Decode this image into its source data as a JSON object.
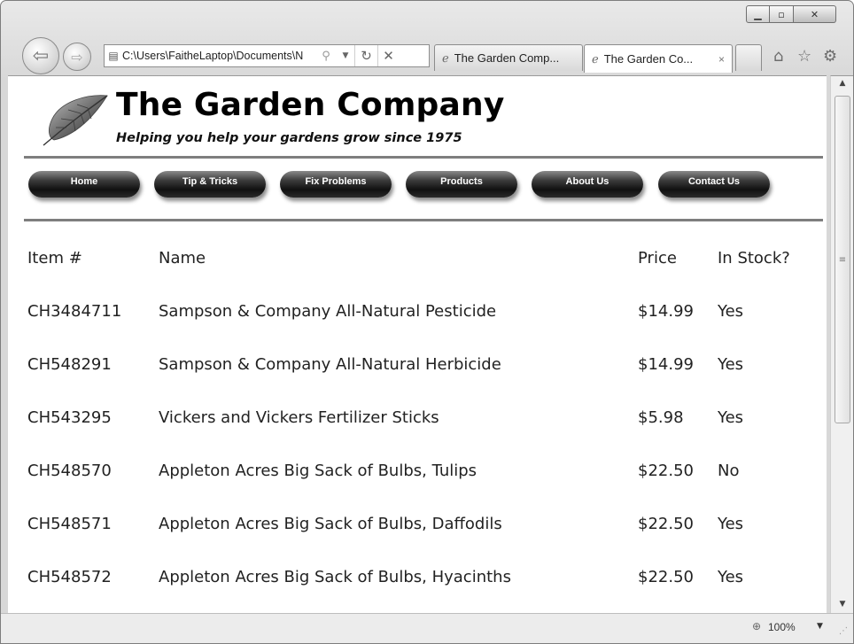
{
  "browser": {
    "address": "C:\\Users\\FaitheLaptop\\Documents\\N",
    "tabs": [
      {
        "title": "The Garden Comp..."
      },
      {
        "title": "The Garden Co...",
        "close": "×"
      }
    ],
    "status": {
      "zoom": "100%"
    }
  },
  "icons": {
    "back": "back-arrow-icon",
    "forward": "forward-arrow-icon",
    "page": "page-icon",
    "search": "search-icon",
    "refresh": "refresh-icon",
    "stop": "stop-icon",
    "home": "home-icon",
    "favorites": "star-icon",
    "tools": "gear-icon",
    "logo": "leaf-icon"
  },
  "site": {
    "title": "The Garden Company",
    "tagline": "Helping you help your gardens grow since 1975",
    "nav": [
      "Home",
      "Tip & Tricks",
      "Fix Problems",
      "Products",
      "About Us",
      "Contact Us"
    ]
  },
  "table": {
    "headers": [
      "Item #",
      "Name",
      "Price",
      "In Stock?"
    ],
    "rows": [
      {
        "item": "CH3484711",
        "name": "Sampson & Company All-Natural Pesticide",
        "price": "$14.99",
        "stock": "Yes"
      },
      {
        "item": "CH548291",
        "name": "Sampson & Company All-Natural Herbicide",
        "price": "$14.99",
        "stock": "Yes"
      },
      {
        "item": "CH543295",
        "name": "Vickers and Vickers Fertilizer Sticks",
        "price": "$5.98",
        "stock": "Yes"
      },
      {
        "item": "CH548570",
        "name": "Appleton Acres Big Sack of Bulbs, Tulips",
        "price": "$22.50",
        "stock": "No"
      },
      {
        "item": "CH548571",
        "name": "Appleton Acres Big Sack of Bulbs, Daffodils",
        "price": "$22.50",
        "stock": "Yes"
      },
      {
        "item": "CH548572",
        "name": "Appleton Acres Big Sack of Bulbs, Hyacinths",
        "price": "$22.50",
        "stock": "Yes"
      }
    ]
  },
  "colors": {
    "nav_pill": "#1c1c1c",
    "rule": "#7e7e7e"
  }
}
